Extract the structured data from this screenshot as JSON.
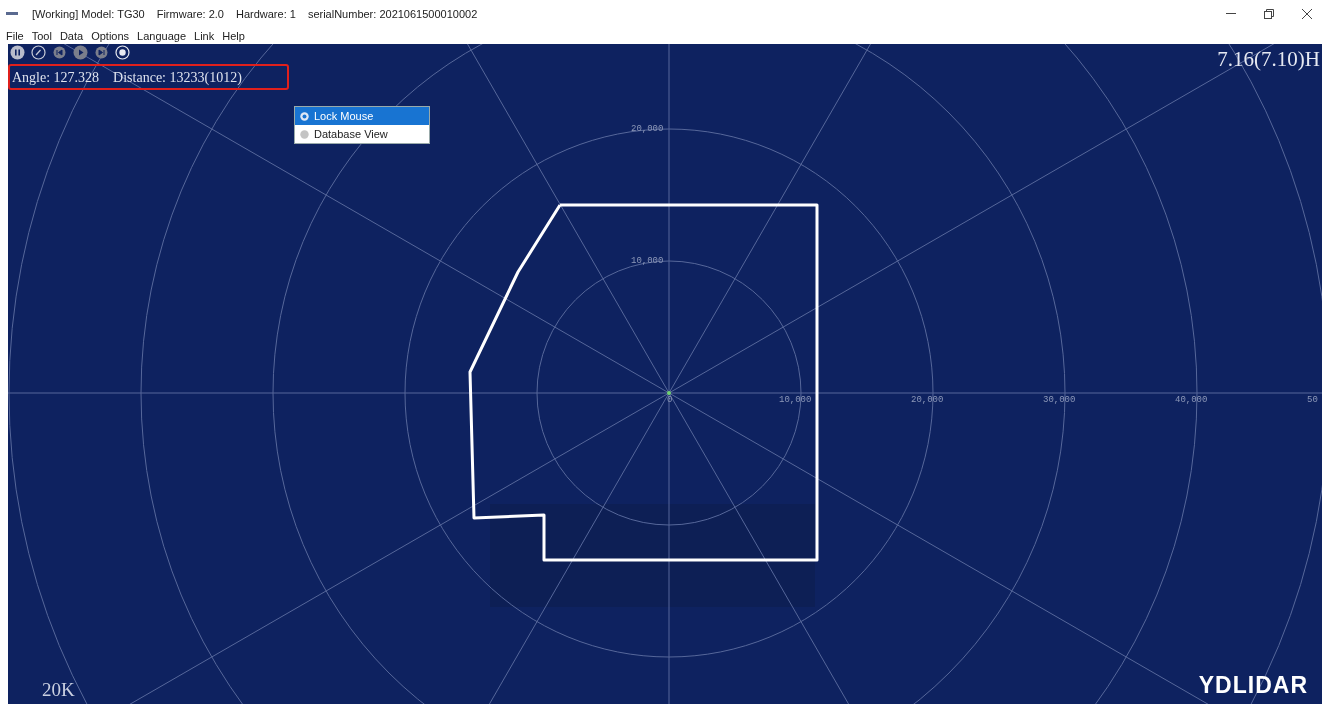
{
  "window": {
    "title_parts": [
      "[Working] Model: TG30",
      "Firmware: 2.0",
      "Hardware: 1",
      "serialNumber: 2021061500010002"
    ]
  },
  "menu": [
    "File",
    "Tool",
    "Data",
    "Options",
    "Language",
    "Link",
    "Help"
  ],
  "toolbar": [
    {
      "kind": "pause"
    },
    {
      "kind": "gauge"
    },
    {
      "kind": "previous"
    },
    {
      "kind": "play"
    },
    {
      "kind": "next"
    },
    {
      "kind": "record"
    }
  ],
  "readout": {
    "angle": "Angle: 127.328",
    "distance": "Distance: 13233(1012)",
    "highlighted": true
  },
  "frequency": "7.16(7.10)H",
  "popup_menu": [
    {
      "label": "Lock Mouse",
      "selected": true
    },
    {
      "label": "Database View",
      "selected": false
    }
  ],
  "plot": {
    "x_labels": [
      "0",
      "10,000",
      "20,000",
      "30,000",
      "40,000",
      "50"
    ],
    "y_labels": [
      "20,000",
      "10,000"
    ]
  },
  "range": "20K",
  "logo": "YDLIDAR"
}
